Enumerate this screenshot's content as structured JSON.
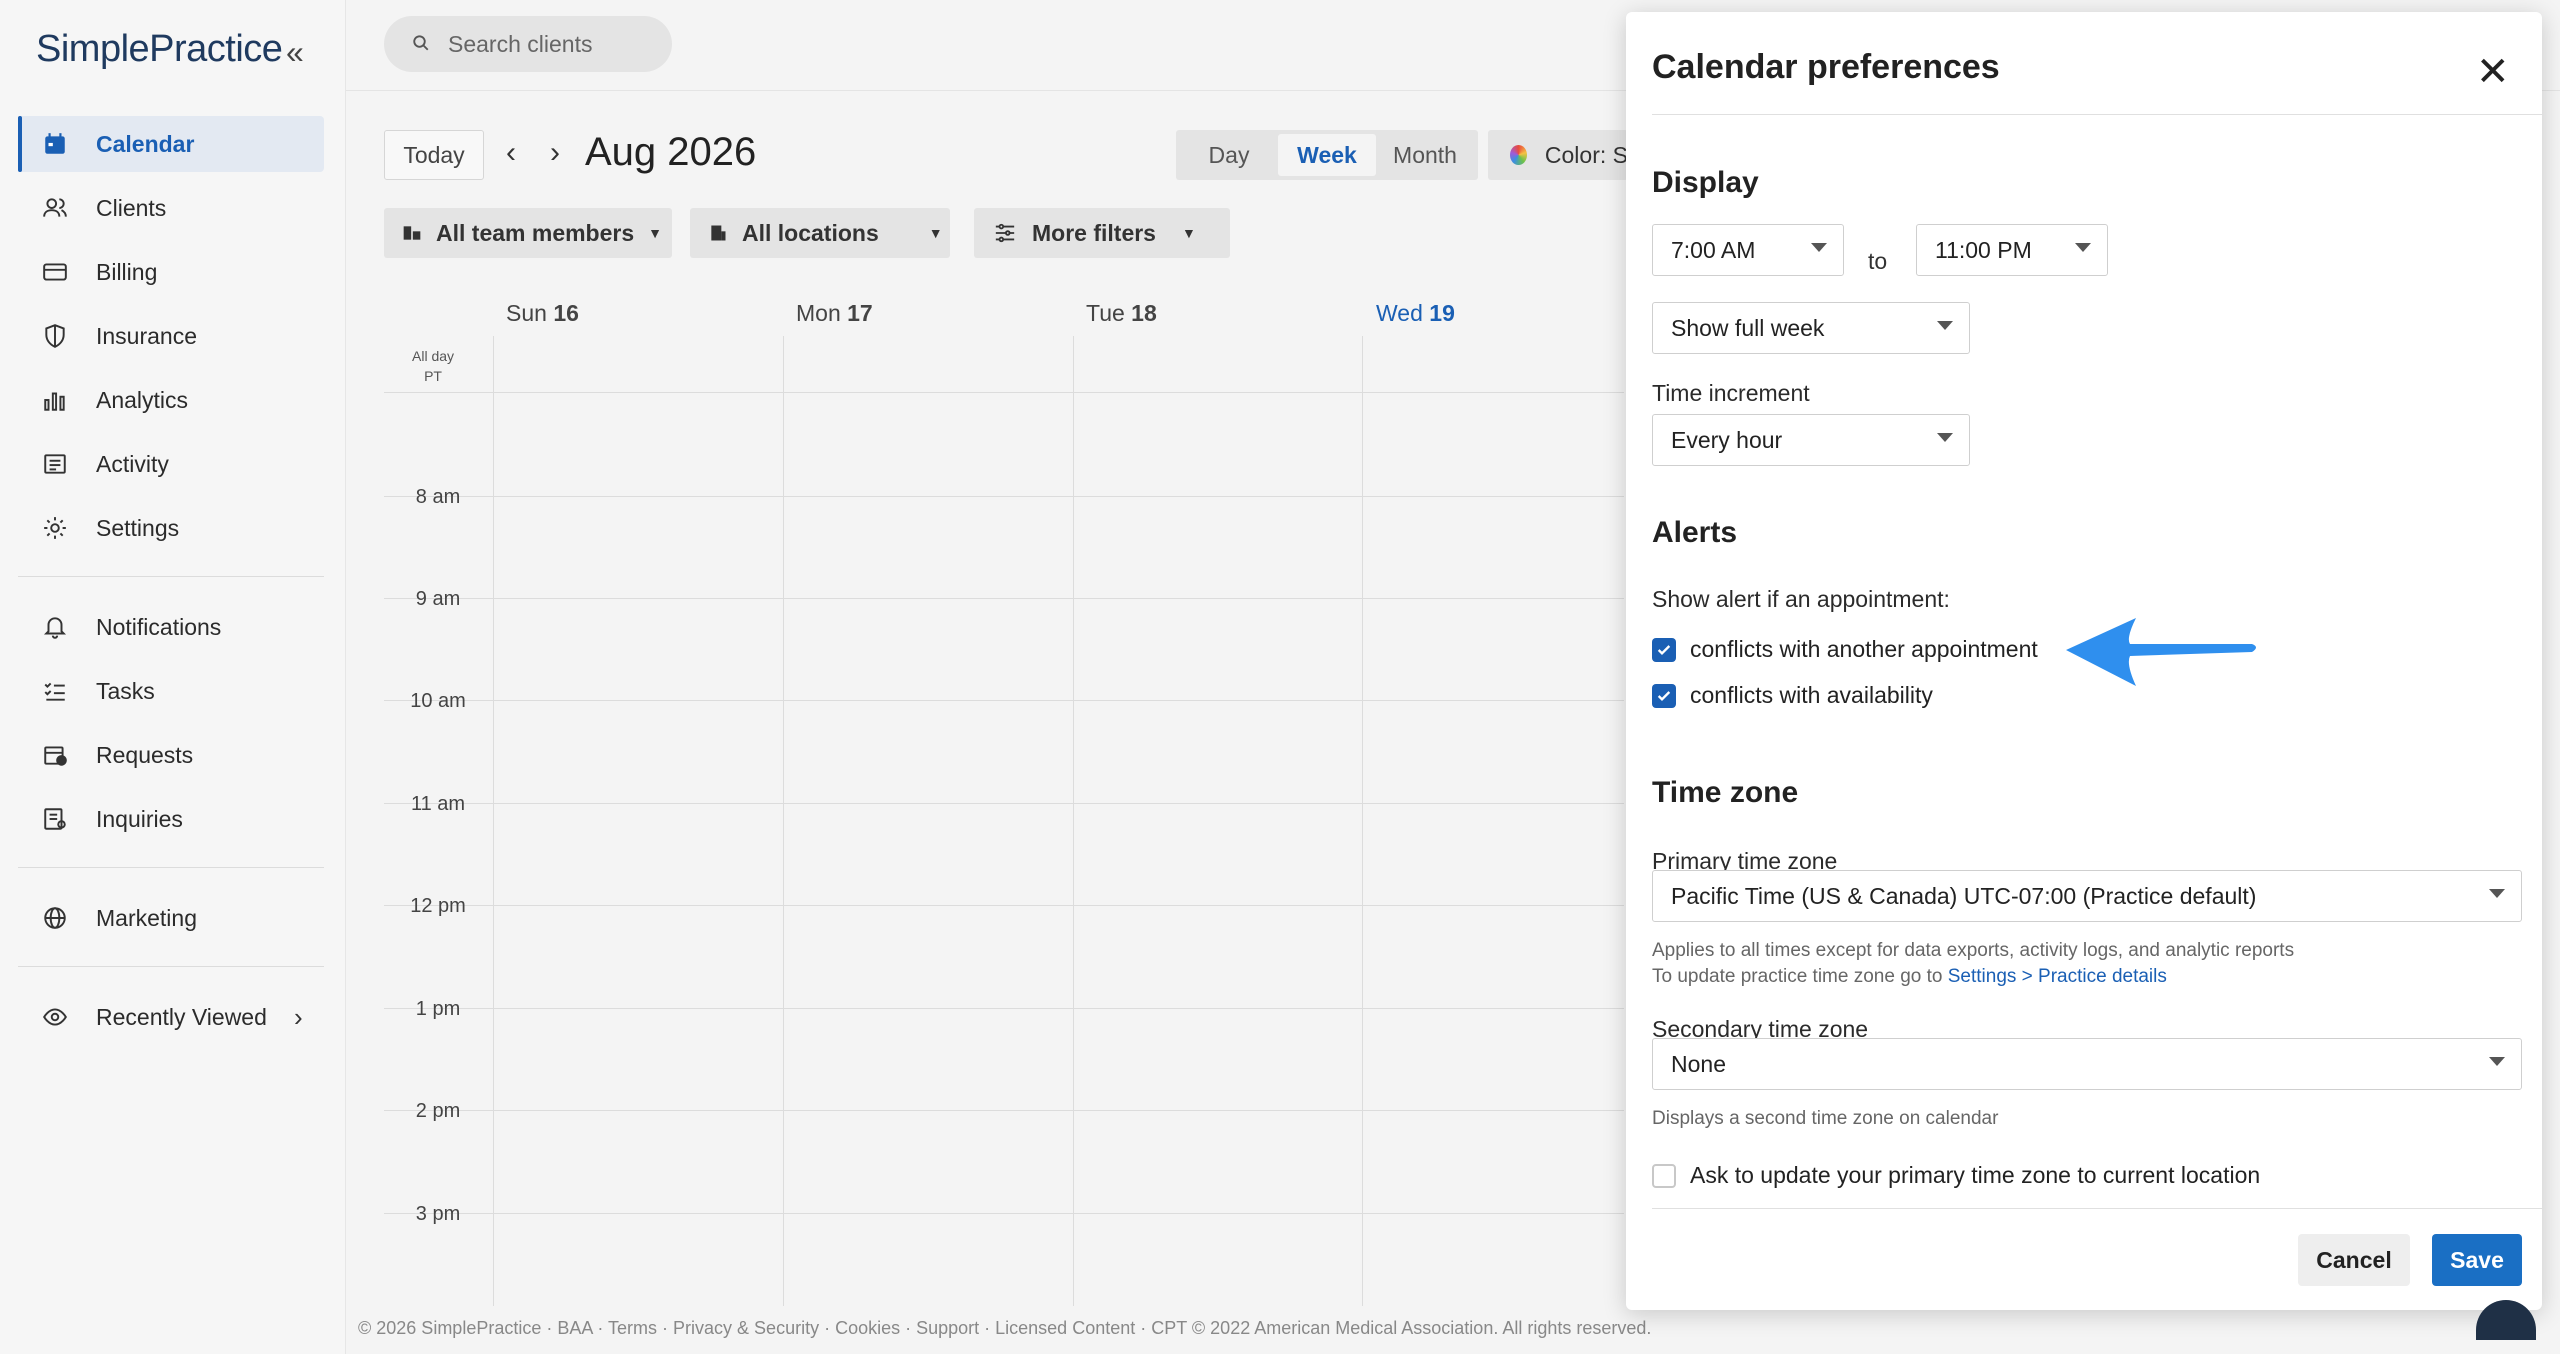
{
  "app": {
    "logo_text": "SimplePractice",
    "colors": {
      "accent": "#1a5fb4",
      "save": "#1a6fc4",
      "arrow": "#2f8fee"
    }
  },
  "sidebar": {
    "items": [
      {
        "label": "Calendar",
        "icon": "calendar-icon"
      },
      {
        "label": "Clients",
        "icon": "clients-icon"
      },
      {
        "label": "Billing",
        "icon": "billing-card-icon"
      },
      {
        "label": "Insurance",
        "icon": "shield-icon"
      },
      {
        "label": "Analytics",
        "icon": "bar-chart-icon"
      },
      {
        "label": "Activity",
        "icon": "activity-list-icon"
      },
      {
        "label": "Settings",
        "icon": "gear-icon"
      },
      {
        "label": "Notifications",
        "icon": "bell-icon"
      },
      {
        "label": "Tasks",
        "icon": "tasks-icon"
      },
      {
        "label": "Requests",
        "icon": "calendar-request-icon"
      },
      {
        "label": "Inquiries",
        "icon": "inquiries-icon"
      },
      {
        "label": "Marketing",
        "icon": "globe-icon"
      },
      {
        "label": "Recently Viewed",
        "icon": "eye-icon"
      }
    ]
  },
  "search": {
    "placeholder": "Search clients"
  },
  "calendar": {
    "today_label": "Today",
    "month_title": "Aug 2026",
    "views": [
      "Day",
      "Week",
      "Month"
    ],
    "active_view": "Week",
    "color_label": "Color: S",
    "filters": {
      "team": "All team members",
      "locations": "All locations",
      "more": "More filters"
    },
    "days": [
      {
        "name": "Sun",
        "num": "16"
      },
      {
        "name": "Mon",
        "num": "17"
      },
      {
        "name": "Tue",
        "num": "18"
      },
      {
        "name": "Wed",
        "num": "19"
      }
    ],
    "allday_label": "All day",
    "tz_label": "PT",
    "hours": [
      "8 am",
      "9 am",
      "10 am",
      "11 am",
      "12 pm",
      "1 pm",
      "2 pm",
      "3 pm"
    ]
  },
  "footer": {
    "text": "© 2026 SimplePractice · BAA · Terms · Privacy & Security · Cookies · Support · Licensed Content · CPT © 2022 American Medical Association. All rights reserved."
  },
  "panel": {
    "title": "Calendar preferences",
    "display": {
      "title": "Display",
      "start_time": "7:00 AM",
      "to_label": "to",
      "end_time": "11:00 PM",
      "week_option": "Show full week",
      "increment_label": "Time increment",
      "increment_value": "Every hour"
    },
    "alerts": {
      "title": "Alerts",
      "intro": "Show alert if an appointment:",
      "conflict_appointment": "conflicts with another appointment",
      "conflict_availability": "conflicts with availability"
    },
    "timezone": {
      "title": "Time zone",
      "primary_label": "Primary time zone",
      "primary_value": "Pacific Time (US & Canada) UTC-07:00 (Practice default)",
      "primary_help_1": "Applies to all times except for data exports, activity logs, and analytic reports",
      "primary_help_2": "To update practice time zone go to ",
      "primary_help_link": "Settings > Practice details",
      "secondary_label": "Secondary time zone",
      "secondary_value": "None",
      "secondary_help": "Displays a second time zone on calendar",
      "ask_update": "Ask to update your primary time zone to current location"
    },
    "buttons": {
      "cancel": "Cancel",
      "save": "Save"
    }
  }
}
